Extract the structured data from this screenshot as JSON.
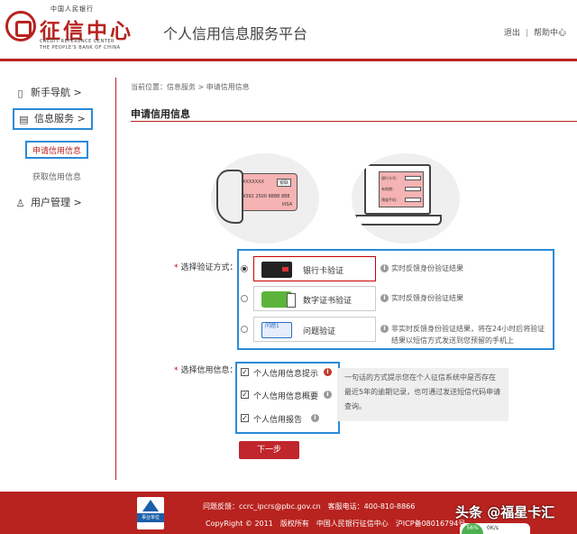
{
  "header": {
    "logo_small": "中国人民银行",
    "logo_main": "征信中心",
    "logo_en1": "CREDIT REFERENCE CENTER",
    "logo_en2": "THE PEOPLE'S BANK OF CHINA",
    "site_title": "个人信用信息服务平台",
    "logout": "退出",
    "help": "帮助中心",
    "separator": "|"
  },
  "sidebar": {
    "items": [
      {
        "label": "新手导航 >",
        "icon": "book-icon"
      },
      {
        "label": "信息服务 >",
        "icon": "document-icon"
      },
      {
        "label": "用户管理 >",
        "icon": "user-icon"
      }
    ],
    "subitems": [
      {
        "label": "申请信用信息"
      },
      {
        "label": "获取信用信息"
      }
    ]
  },
  "content": {
    "breadcrumb": "当前位置：信息服务 > 申请信用信息",
    "title": "申请信用信息",
    "card_illus": {
      "number1": "XXXXXXX",
      "badge": "银联",
      "number2": "4392 2500 8888 888",
      "brand": "VISA"
    },
    "form_illus": {
      "label1": "银行卡号：",
      "label2": "有效期：",
      "label3": "预留手机："
    },
    "verify_label": "选择验证方式：",
    "required_mark": "*",
    "verify_options": [
      {
        "label": "银行卡验证",
        "desc": "实时反馈身份验证结果",
        "selected": true
      },
      {
        "label": "数字证书验证",
        "desc": "实时反馈身份验证结果",
        "selected": false
      },
      {
        "label": "问题验证",
        "desc": "非实时反馈身份验证结果，将在24小时后将验证结果以短信方式发送到您预留的手机上",
        "selected": false
      }
    ],
    "quiz_thumb": "问题1",
    "credit_label": "选择信用信息：",
    "credit_options": [
      {
        "label": "个人信用信息提示",
        "checked": true
      },
      {
        "label": "个人信用信息概要",
        "checked": true
      },
      {
        "label": "个人信用报告",
        "checked": true
      }
    ],
    "credit_desc": "一句话的方式提示您在个人征信系统中是否存在最近5年的逾期记录，也可通过发送短信代码申请查询。",
    "next_button": "下一步"
  },
  "footer": {
    "badge": "事业单位",
    "feedback": "问题反馈：ccrc_ipcrs@pbc.gov.cn",
    "phone": "客服电话：400-810-8866",
    "copyright": "CopyRight © 2011",
    "rights": "版权所有",
    "owner": "中国人民银行征信中心",
    "icp": "沪ICP备08016794号",
    "watermark": "头条 @福星卡汇",
    "widget_percent": "56%",
    "widget_speed": "0K/s"
  },
  "colors": {
    "brand_red": "#b8231f",
    "highlight_blue": "#2a8bd8"
  }
}
